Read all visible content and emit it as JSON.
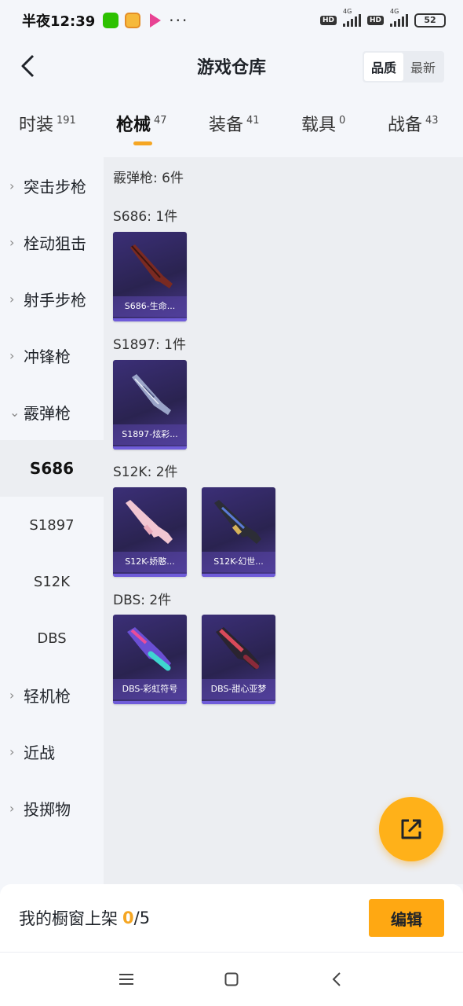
{
  "status_bar": {
    "time": "半夜12:39",
    "more": "···",
    "hd1": "HD",
    "hd2": "HD",
    "net1": "4G",
    "net2": "4G",
    "battery": "52"
  },
  "header": {
    "title": "游戏仓库",
    "sort_options": [
      "品质",
      "最新"
    ],
    "active_sort": "品质"
  },
  "tabs": [
    {
      "label": "时装",
      "count": "191"
    },
    {
      "label": "枪械",
      "count": "47"
    },
    {
      "label": "装备",
      "count": "41"
    },
    {
      "label": "载具",
      "count": "0"
    },
    {
      "label": "战备",
      "count": "43"
    }
  ],
  "active_tab": "枪械",
  "sidebar": {
    "categories": [
      "突击步枪",
      "栓动狙击",
      "射手步枪",
      "冲锋枪",
      "霰弹枪",
      "轻机枪",
      "近战",
      "投掷物"
    ],
    "subcategories": [
      "S686",
      "S1897",
      "S12K",
      "DBS"
    ],
    "expanded": "霰弹枪",
    "active_sub": "S686"
  },
  "content": {
    "group_title": "霰弹枪: 6件",
    "sections": [
      {
        "title": "S686: 1件",
        "items": [
          "S686-生命..."
        ]
      },
      {
        "title": "S1897: 1件",
        "items": [
          "S1897-炫彩..."
        ]
      },
      {
        "title": "S12K: 2件",
        "items": [
          "S12K-娇憨...",
          "S12K-幻世..."
        ]
      },
      {
        "title": "DBS: 2件",
        "items": [
          "DBS-彩虹符号",
          "DBS-甜心亚梦"
        ]
      }
    ]
  },
  "bottom_bar": {
    "label": "我的橱窗上架",
    "count": "0",
    "total": "/5",
    "edit_label": "编辑"
  },
  "colors": {
    "accent": "#f5a623",
    "card_bg": "#2f2660",
    "card_label_bg": "#5a46aa"
  }
}
